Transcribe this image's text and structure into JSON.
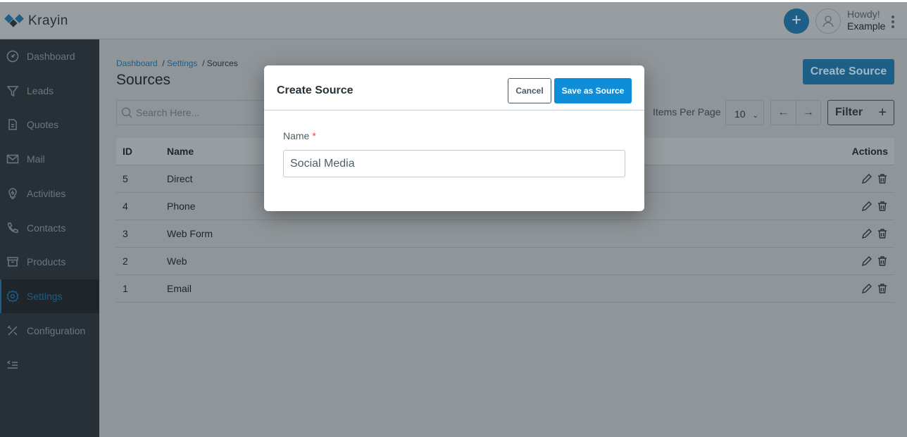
{
  "app": {
    "name": "Krayin",
    "brand_color": "#1d5f87"
  },
  "header": {
    "greeting": "Howdy!",
    "user": "Example"
  },
  "sidebar": {
    "items": [
      {
        "label": "Dashboard",
        "icon": "gauge-icon"
      },
      {
        "label": "Leads",
        "icon": "funnel-icon"
      },
      {
        "label": "Quotes",
        "icon": "document-icon"
      },
      {
        "label": "Mail",
        "icon": "mail-icon"
      },
      {
        "label": "Activities",
        "icon": "bulb-icon"
      },
      {
        "label": "Contacts",
        "icon": "phone-icon"
      },
      {
        "label": "Products",
        "icon": "archive-icon"
      },
      {
        "label": "Settings",
        "icon": "gear-icon",
        "active": true
      },
      {
        "label": "Configuration",
        "icon": "tools-icon"
      }
    ]
  },
  "breadcrumb": [
    {
      "label": "Dashboard"
    },
    {
      "label": "Settings"
    },
    {
      "label": "Sources"
    }
  ],
  "page": {
    "title": "Sources",
    "create_label": "Create Source",
    "search_placeholder": "Search Here...",
    "items_per_page_label": "Items Per Page",
    "items_per_page": "10",
    "filter_label": "Filter"
  },
  "table": {
    "columns": [
      "ID",
      "Name",
      "Actions"
    ],
    "rows": [
      {
        "id": "5",
        "name": "Direct"
      },
      {
        "id": "4",
        "name": "Phone"
      },
      {
        "id": "3",
        "name": "Web Form"
      },
      {
        "id": "2",
        "name": "Web"
      },
      {
        "id": "1",
        "name": "Email"
      }
    ]
  },
  "modal": {
    "title": "Create Source",
    "cancel": "Cancel",
    "save": "Save as Source",
    "field_label": "Name",
    "required_mark": "*",
    "field_value": "Social Media"
  }
}
